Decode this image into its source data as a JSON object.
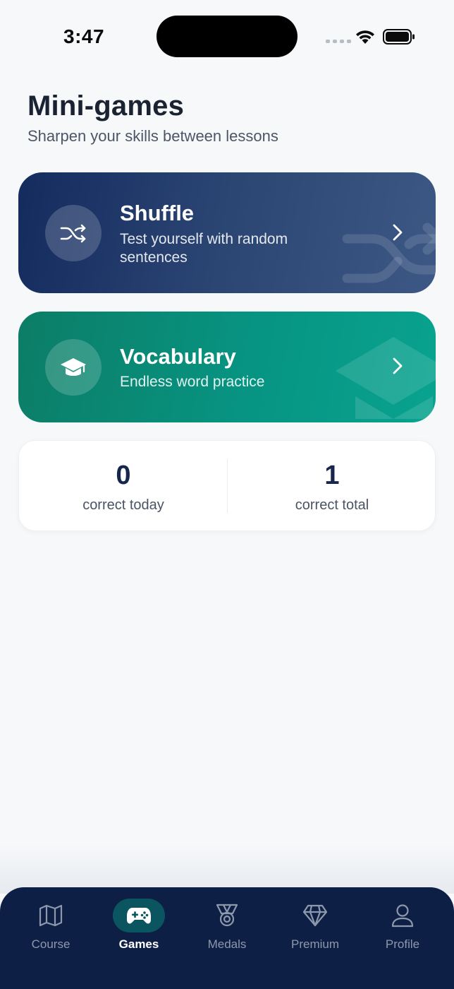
{
  "status_bar": {
    "time": "3:47"
  },
  "header": {
    "title": "Mini-games",
    "subtitle": "Sharpen your skills between lessons"
  },
  "games": [
    {
      "title": "Shuffle",
      "description": "Test yourself with random sentences",
      "icon": "shuffle-icon",
      "color": "#1f3a6b"
    },
    {
      "title": "Vocabulary",
      "description": "Endless word practice",
      "icon": "graduation-cap-icon",
      "color": "#0a8c78"
    }
  ],
  "stats": [
    {
      "value": "0",
      "label": "correct today"
    },
    {
      "value": "1",
      "label": "correct total"
    }
  ],
  "nav": {
    "active": "Games",
    "items": [
      {
        "label": "Course",
        "icon": "map-icon"
      },
      {
        "label": "Games",
        "icon": "gamepad-icon"
      },
      {
        "label": "Medals",
        "icon": "medal-icon"
      },
      {
        "label": "Premium",
        "icon": "diamond-icon"
      },
      {
        "label": "Profile",
        "icon": "user-icon"
      }
    ]
  },
  "colors": {
    "background": "#f6f8fa",
    "nav_background": "#0e1f45",
    "nav_active": "#0b5560",
    "stat_value": "#16264d"
  }
}
